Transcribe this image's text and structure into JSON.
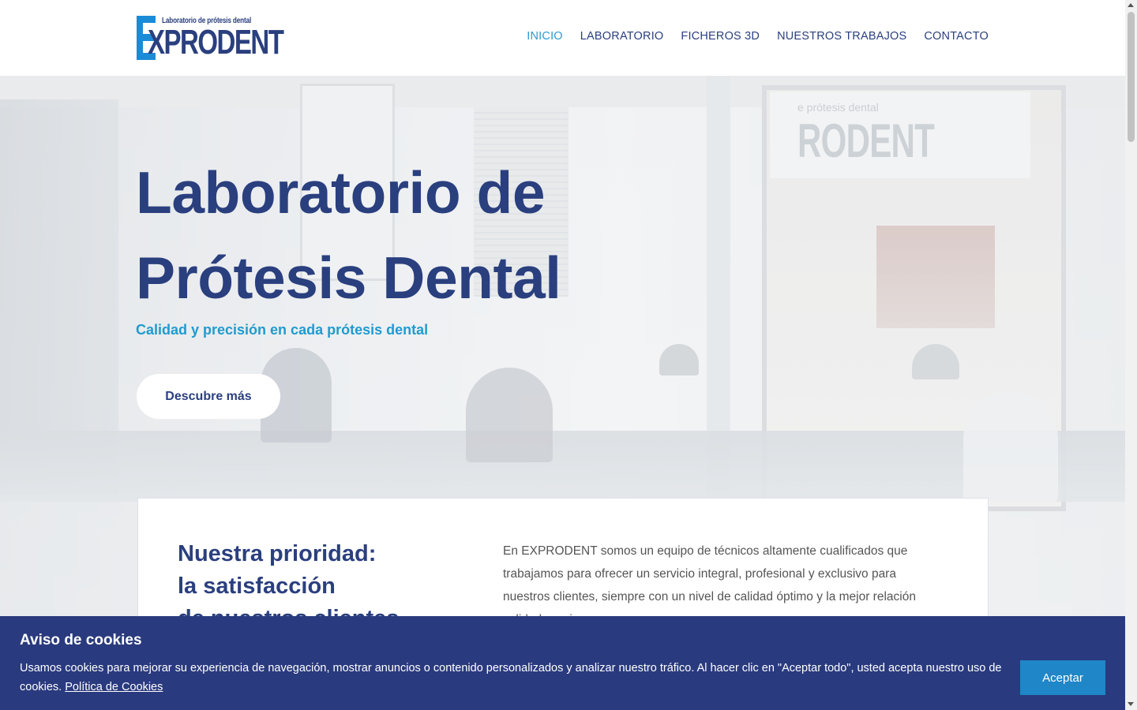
{
  "brand": {
    "logo_subtitle": "Laboratorio de prótesis dental",
    "logo_word": "XPRODENT",
    "colors": {
      "primary": "#2a3f7e",
      "accent": "#1f9bcf",
      "logo_blue": "#1c8bd6"
    }
  },
  "nav": {
    "items": [
      {
        "label": "INICIO",
        "active": true
      },
      {
        "label": "LABORATORIO"
      },
      {
        "label": "FICHEROS 3D"
      },
      {
        "label": "NUESTROS TRABAJOS"
      },
      {
        "label": "CONTACTO"
      }
    ]
  },
  "hero": {
    "title_line1": "Laboratorio de",
    "title_line2": "Prótesis Dental",
    "subtitle": "Calidad y precisión en cada prótesis dental",
    "cta_label": "Descubre más",
    "background_sign_text": "RODENT",
    "background_sign_sub": "e prótesis dental"
  },
  "intro": {
    "title_line1": "Nuestra prioridad:",
    "title_line2": "la satisfacción",
    "title_line3": "de nuestros clientes",
    "text": "En EXPRODENT somos un equipo de técnicos altamente cualificados que trabajamos para ofrecer un servicio integral, profesional y exclusivo para nuestros clientes, siempre con un nivel de calidad óptimo y la mejor relación calidad-precio."
  },
  "cookies": {
    "title": "Aviso de cookies",
    "text": "Usamos cookies para mejorar su experiencia de navegación, mostrar anuncios o contenido personalizados y analizar nuestro tráfico. Al hacer clic en \"Aceptar todo\", usted acepta nuestro uso de cookies.",
    "policy_link": "Política de Cookies",
    "accept_label": "Aceptar"
  }
}
